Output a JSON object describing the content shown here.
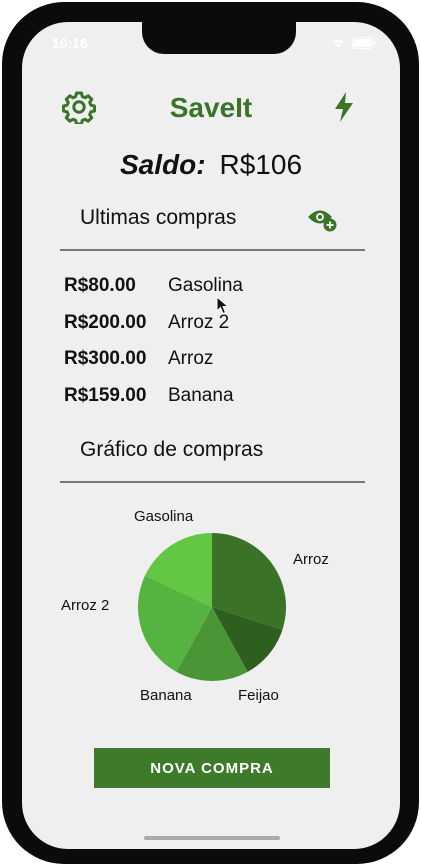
{
  "status": {
    "time": "10:16"
  },
  "header": {
    "title": "SaveIt"
  },
  "balance": {
    "label": "Saldo:",
    "value": "R$106"
  },
  "recent": {
    "title": "Ultimas compras",
    "items": [
      {
        "amount": "R$80.00",
        "name": "Gasolina"
      },
      {
        "amount": "R$200.00",
        "name": "Arroz 2"
      },
      {
        "amount": "R$300.00",
        "name": "Arroz"
      },
      {
        "amount": "R$159.00",
        "name": "Banana"
      }
    ]
  },
  "chart_section": {
    "title": "Gráfico de compras"
  },
  "chart_data": {
    "type": "pie",
    "labels": [
      "Arroz",
      "Feijao",
      "Banana",
      "Arroz 2",
      "Gasolina"
    ],
    "values": [
      30,
      12,
      16,
      24,
      18
    ],
    "colors": [
      "#3a7327",
      "#2f5f1f",
      "#4a9636",
      "#55b33f",
      "#62c843"
    ]
  },
  "actions": {
    "new_purchase": "NOVA COMPRA"
  },
  "icons": {
    "settings": "gear-icon",
    "quick": "lightning-icon",
    "visibility": "eye-add-icon"
  },
  "colors": {
    "accent": "#3a7427"
  }
}
